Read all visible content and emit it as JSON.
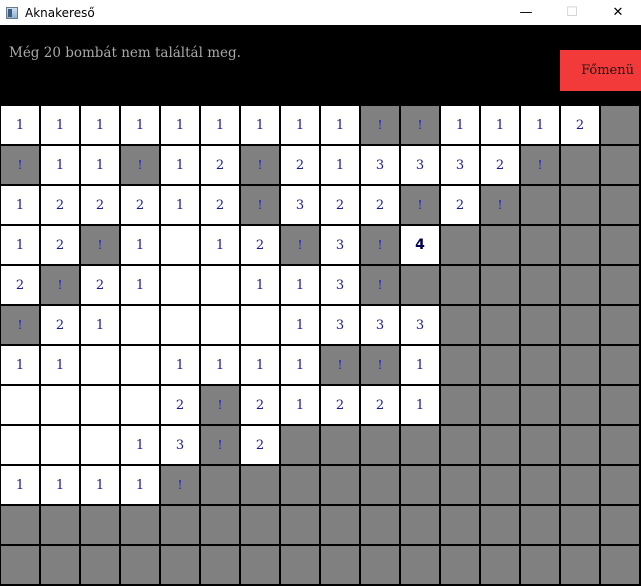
{
  "window": {
    "title": "Aknakereső",
    "minimize": "—",
    "maximize": "☐",
    "close": "✕"
  },
  "header": {
    "status": "Még 20 bombát nem találtál meg.",
    "menu_button": "Főmenü",
    "menu_color": "#f33a3a"
  },
  "colors": {
    "revealed": "#ffffff",
    "hidden": "#808080",
    "number": "#1a1a8c",
    "flag": "#1b1bd0"
  },
  "board": {
    "columns": 16,
    "rows": [
      [
        "1",
        "1",
        "1",
        "1",
        "1",
        "1",
        "1",
        "1",
        "1",
        "!",
        "!",
        "1",
        "1",
        "1",
        "2",
        "#"
      ],
      [
        "!",
        "1",
        "1",
        "!",
        "1",
        "2",
        "!",
        "2",
        "1",
        "3",
        "3",
        "3",
        "2",
        "!",
        "#",
        "#"
      ],
      [
        "1",
        "2",
        "2",
        "2",
        "1",
        "2",
        "!",
        "3",
        "2",
        "2",
        "!",
        "2",
        "!",
        "#",
        "#",
        "#"
      ],
      [
        "1",
        "2",
        "!",
        "1",
        " ",
        "1",
        "2",
        "!",
        "3",
        "!",
        "4*",
        "#",
        "#",
        "#",
        "#",
        "#"
      ],
      [
        "2",
        "!",
        "2",
        "1",
        " ",
        " ",
        "1",
        "1",
        "3",
        "!",
        "#",
        "#",
        "#",
        "#",
        "#",
        "#"
      ],
      [
        "!",
        "2",
        "1",
        " ",
        " ",
        " ",
        " ",
        "1",
        "3",
        "3",
        "3",
        "#",
        "#",
        "#",
        "#",
        "#"
      ],
      [
        "1",
        "1",
        " ",
        " ",
        "1",
        "1",
        "1",
        "1",
        "!",
        "!",
        "1",
        "#",
        "#",
        "#",
        "#",
        "#"
      ],
      [
        " ",
        " ",
        " ",
        " ",
        "2",
        "!",
        "2",
        "1",
        "2",
        "2",
        "1",
        "#",
        "#",
        "#",
        "#",
        "#"
      ],
      [
        " ",
        " ",
        " ",
        "1",
        "3",
        "!",
        "2",
        "#",
        "#",
        "#",
        "#",
        "#",
        "#",
        "#",
        "#",
        "#"
      ],
      [
        "1",
        "1",
        "1",
        "1",
        "!",
        "#",
        "#",
        "#",
        "#",
        "#",
        "#",
        "#",
        "#",
        "#",
        "#",
        "#"
      ],
      [
        "#",
        "#",
        "#",
        "#",
        "#",
        "#",
        "#",
        "#",
        "#",
        "#",
        "#",
        "#",
        "#",
        "#",
        "#",
        "#"
      ],
      [
        "#",
        "#",
        "#",
        "#",
        "#",
        "#",
        "#",
        "#",
        "#",
        "#",
        "#",
        "#",
        "#",
        "#",
        "#",
        "#"
      ]
    ]
  }
}
